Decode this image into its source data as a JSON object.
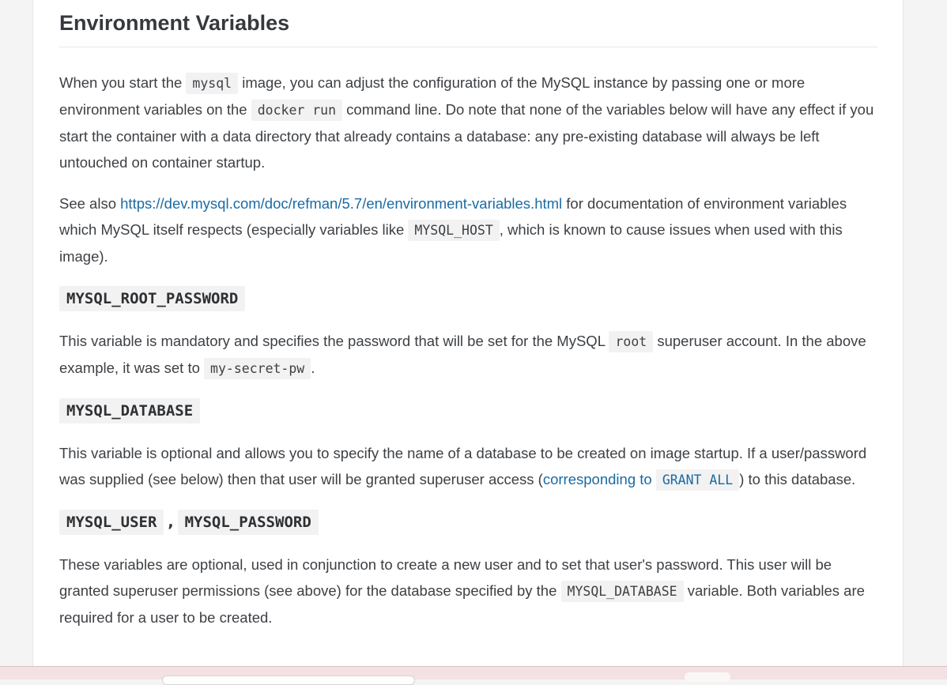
{
  "heading": "Environment Variables",
  "p1": {
    "t1": "When you start the ",
    "c1": "mysql",
    "t2": " image, you can adjust the configuration of the MySQL instance by passing one or more environment variables on the ",
    "c2": "docker run",
    "t3": " command line. Do note that none of the variables below will have any effect if you start the container with a data directory that already contains a database: any pre-existing database will always be left untouched on container startup."
  },
  "p2": {
    "t1": "See also ",
    "link": "https://dev.mysql.com/doc/refman/5.7/en/environment-variables.html",
    "t2": " for documentation of environment variables which MySQL itself respects (especially variables like ",
    "c1": "MYSQL_HOST",
    "t3": ", which is known to cause issues when used with this image)."
  },
  "root_password": {
    "title": "MYSQL_ROOT_PASSWORD",
    "t1": "This variable is mandatory and specifies the password that will be set for the MySQL ",
    "c1": "root",
    "t2": " superuser account. In the above example, it was set to ",
    "c2": "my-secret-pw",
    "t3": "."
  },
  "database": {
    "title": "MYSQL_DATABASE",
    "t1": "This variable is optional and allows you to specify the name of a database to be created on image startup. If a user/password was supplied (see below) then that user will be granted superuser access (",
    "link_text": "corresponding to ",
    "link_code": "GRANT ALL",
    "t2": ") to this database."
  },
  "user": {
    "title1": "MYSQL_USER",
    "comma": ",",
    "title2": "MYSQL_PASSWORD",
    "t1": "These variables are optional, used in conjunction to create a new user and to set that user's password. This user will be granted superuser permissions (see above) for the database specified by the ",
    "c1": "MYSQL_DATABASE",
    "t2": " variable. Both variables are required for a user to be created."
  }
}
